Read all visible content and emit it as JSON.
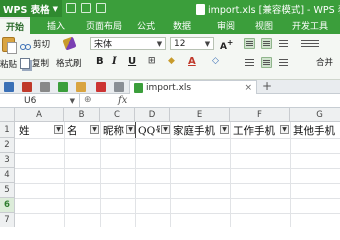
{
  "app": {
    "name": "WPS 表格",
    "title": "import.xls [兼容模式] - WPS 表格"
  },
  "ribbon_tabs": [
    "开始",
    "插入",
    "页面布局",
    "公式",
    "数据",
    "审阅",
    "视图",
    "开发工具"
  ],
  "ribbon": {
    "cut_label": "剪切",
    "copy_label": "复制",
    "format_painter_label": "格式刷",
    "paste_label": "粘贴",
    "font_name": "宋体",
    "font_size": "12",
    "merge_label": "合并",
    "bold": "B",
    "italic": "I",
    "underline": "U"
  },
  "doc_tab": {
    "name": "import.xls",
    "close": "×",
    "new_tab": "+"
  },
  "formula_bar": {
    "cell_ref": "U6",
    "fx": "fx",
    "value": ""
  },
  "sheet": {
    "columns": [
      "A",
      "B",
      "C",
      "D",
      "E",
      "F",
      "G"
    ],
    "rows": [
      "1",
      "2",
      "3",
      "4",
      "5",
      "6",
      "7"
    ],
    "selected_row": "6",
    "header_row": [
      "姓",
      "名",
      "昵称",
      "QQ号",
      "家庭手机",
      "工作手机",
      "其他手机"
    ],
    "filter_glyph": "▼"
  }
}
